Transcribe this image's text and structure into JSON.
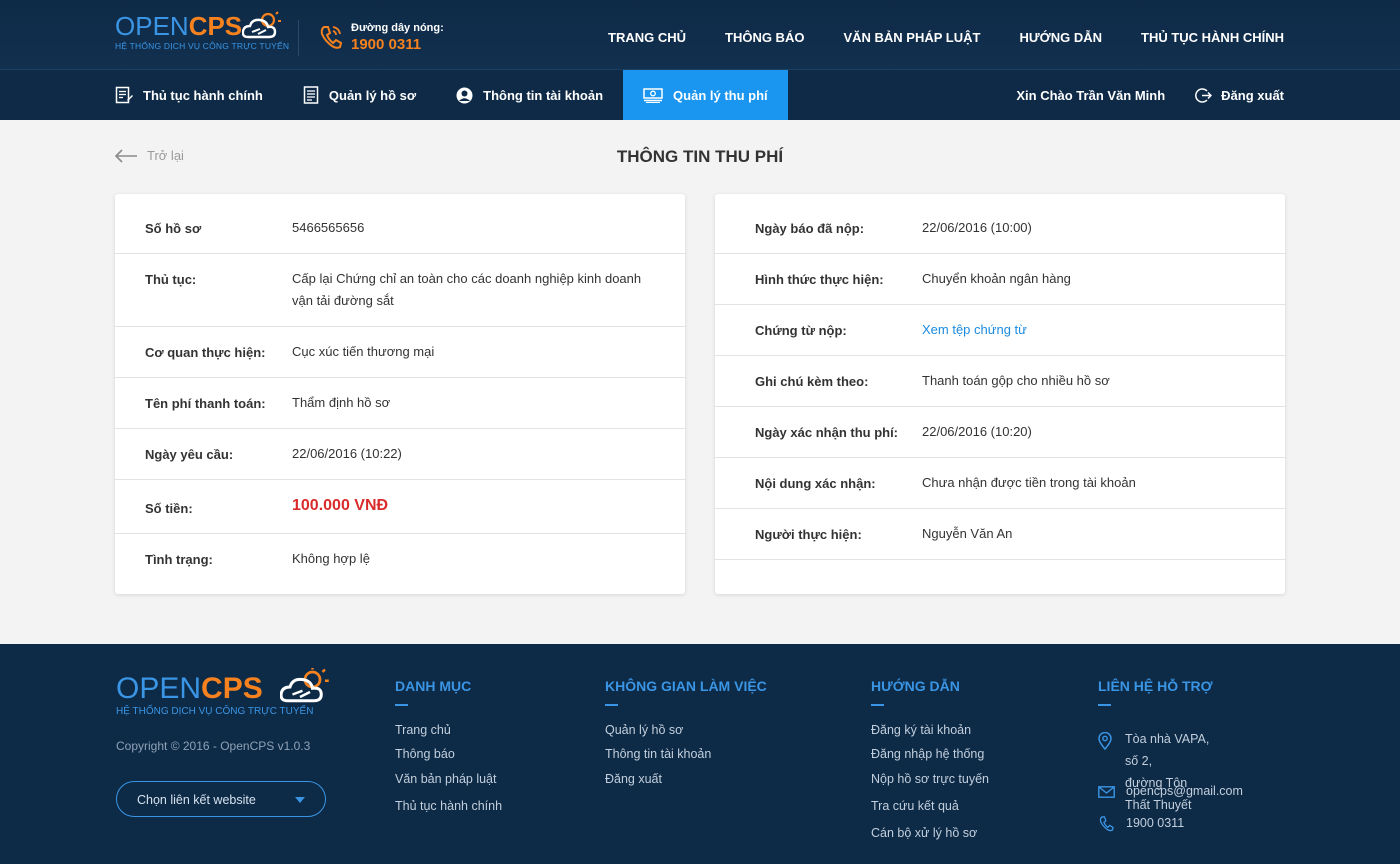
{
  "header": {
    "logo_open": "OPEN",
    "logo_cps": "CPS",
    "logo_tagline": "HỆ THỐNG DỊCH VỤ CÔNG TRỰC TUYẾN",
    "hotline_label": "Đường dây nóng:",
    "hotline_number": "1900 0311",
    "nav": [
      "TRANG CHỦ",
      "THÔNG BÁO",
      "VĂN BẢN PHÁP LUẬT",
      "HƯỚNG DẪN",
      "THỦ TỤC HÀNH CHÍNH"
    ]
  },
  "subnav": {
    "items": [
      {
        "label": "Thủ tục hành chính",
        "icon": "document-pen-icon"
      },
      {
        "label": "Quản lý hồ sơ",
        "icon": "file-list-icon"
      },
      {
        "label": "Thông tin tài khoản",
        "icon": "user-circle-icon"
      },
      {
        "label": "Quản lý thu phí",
        "icon": "money-icon",
        "active": true
      }
    ],
    "greeting": "Xin Chào Trần Văn Minh",
    "logout": "Đăng xuất"
  },
  "page": {
    "back": "Trở lại",
    "title": "THÔNG TIN THU PHÍ"
  },
  "left_card": [
    {
      "label": "Số hồ sơ",
      "value": "5466565656"
    },
    {
      "label": "Thủ tục:",
      "value": "Cấp lại Chứng chỉ an toàn cho các doanh nghiệp kinh doanh vận tải đường sắt"
    },
    {
      "label": "Cơ quan thực hiện:",
      "value": "Cục xúc tiến thương mại"
    },
    {
      "label": "Tên phí thanh toán:",
      "value": "Thẩm định hồ sơ"
    },
    {
      "label": "Ngày yêu cầu:",
      "value": "22/06/2016 (10:22)"
    },
    {
      "label": "Số tiền:",
      "value": "100.000 VNĐ"
    },
    {
      "label": "Tình trạng:",
      "value": "Không hợp lệ"
    }
  ],
  "right_card": [
    {
      "label": "Ngày báo đã nộp:",
      "value": "22/06/2016 (10:00)"
    },
    {
      "label": "Hình thức thực hiện:",
      "value": "Chuyển khoản ngân hàng"
    },
    {
      "label": "Chứng từ nộp:",
      "value": "Xem tệp chứng từ"
    },
    {
      "label": "Ghi chú kèm theo:",
      "value": "Thanh toán gộp cho nhiều hồ sơ"
    },
    {
      "label": "Ngày xác nhận thu phí:",
      "value": "22/06/2016 (10:20)"
    },
    {
      "label": "Nội dung xác nhận:",
      "value": "Chưa nhận được tiền trong tài khoản"
    },
    {
      "label": "Người thực hiện:",
      "value": "Nguyễn Văn An"
    }
  ],
  "footer": {
    "copyright": "Copyright © 2016 - OpenCPS v1.0.3",
    "select_placeholder": "Chọn liên kết website",
    "columns": [
      {
        "title": "DANH MỤC",
        "links": [
          "Trang chủ",
          "Thông báo",
          "Văn bản pháp luật",
          "Thủ tục hành chính"
        ]
      },
      {
        "title": "KHÔNG GIAN LÀM VIỆC",
        "links": [
          "Quản lý hồ sơ",
          "Thông tin tài khoản",
          "Đăng xuất"
        ]
      },
      {
        "title": "HƯỚNG DẪN",
        "links": [
          "Đăng ký tài khoản",
          "Đăng nhập hệ thống",
          "Nộp hồ sơ trực tuyến",
          "Tra cứu kết quả",
          "Cán bộ xử lý hồ sơ"
        ]
      }
    ],
    "contact": {
      "title": "LIÊN HỆ HỖ TRỢ",
      "address_line1": "Tòa nhà VAPA, số 2,",
      "address_line2": "đường Tôn Thất Thuyết",
      "email": "opencps@gmail.com",
      "phone": "1900 0311"
    }
  },
  "colors": {
    "header_bg": "#0e2a47",
    "accent_blue": "#1a96f0",
    "accent_orange": "#f5821f",
    "amount_red": "#d92c2c"
  }
}
